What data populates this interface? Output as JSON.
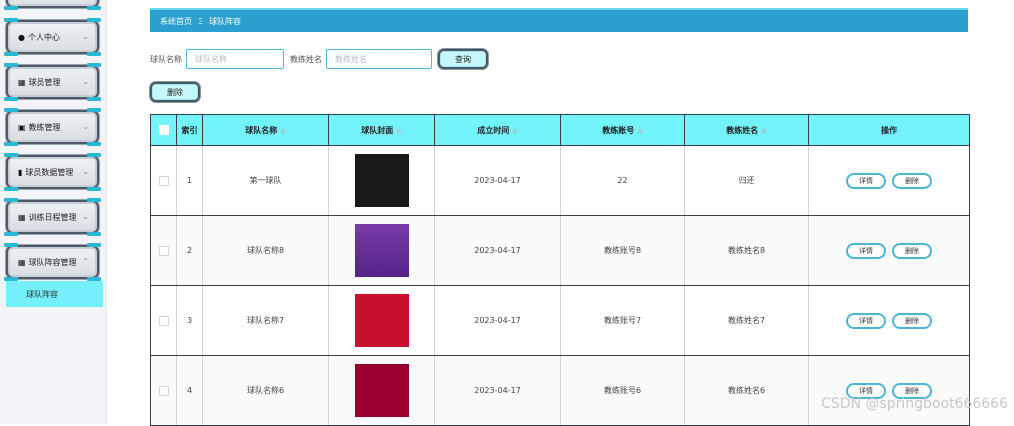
{
  "sidebar": {
    "items": [
      {
        "label": "个人中心",
        "icon": "user-icon"
      },
      {
        "label": "球员管理",
        "icon": "grid-icon"
      },
      {
        "label": "教练管理",
        "icon": "briefcase-icon"
      },
      {
        "label": "球员数据管理",
        "icon": "clipboard-icon"
      },
      {
        "label": "训练日程管理",
        "icon": "grid-icon"
      },
      {
        "label": "球队阵容管理",
        "icon": "grid-icon"
      }
    ],
    "submenu_label": "球队阵容"
  },
  "breadcrumb": {
    "home": "系统首页",
    "separator": "Ξ",
    "current": "球队阵容"
  },
  "search": {
    "team_label": "球队名称",
    "team_placeholder": "球队名称",
    "coach_label": "教练姓名",
    "coach_placeholder": "教练姓名",
    "search_button": "查询"
  },
  "toolbar": {
    "delete_button": "删除"
  },
  "table": {
    "headers": {
      "index": "索引",
      "name": "球队名称",
      "cover": "球队封面",
      "date": "成立时间",
      "account": "教练账号",
      "coach": "教练姓名",
      "ops": "操作"
    },
    "rows": [
      {
        "index": "1",
        "name": "第一球队",
        "date": "2023-04-17",
        "account": "22",
        "coach": "归还",
        "cover": "cover-grid"
      },
      {
        "index": "2",
        "name": "球队名称8",
        "date": "2023-04-17",
        "account": "教练账号8",
        "coach": "教练姓名8",
        "cover": "cover-purple"
      },
      {
        "index": "3",
        "name": "球队名称7",
        "date": "2023-04-17",
        "account": "教练账号7",
        "coach": "教练姓名7",
        "cover": "cover-red"
      },
      {
        "index": "4",
        "name": "球队名称6",
        "date": "2023-04-17",
        "account": "教练账号6",
        "coach": "教练姓名6",
        "cover": "cover-heat"
      }
    ],
    "detail_button": "详情",
    "delete_button": "删除"
  },
  "watermark": "CSDN @springboot666666",
  "colors": {
    "accent": "#2b9fcd",
    "header_bg": "#73f4fb",
    "submenu_bg": "#73f0fb",
    "button_border": "#49b6d6"
  }
}
